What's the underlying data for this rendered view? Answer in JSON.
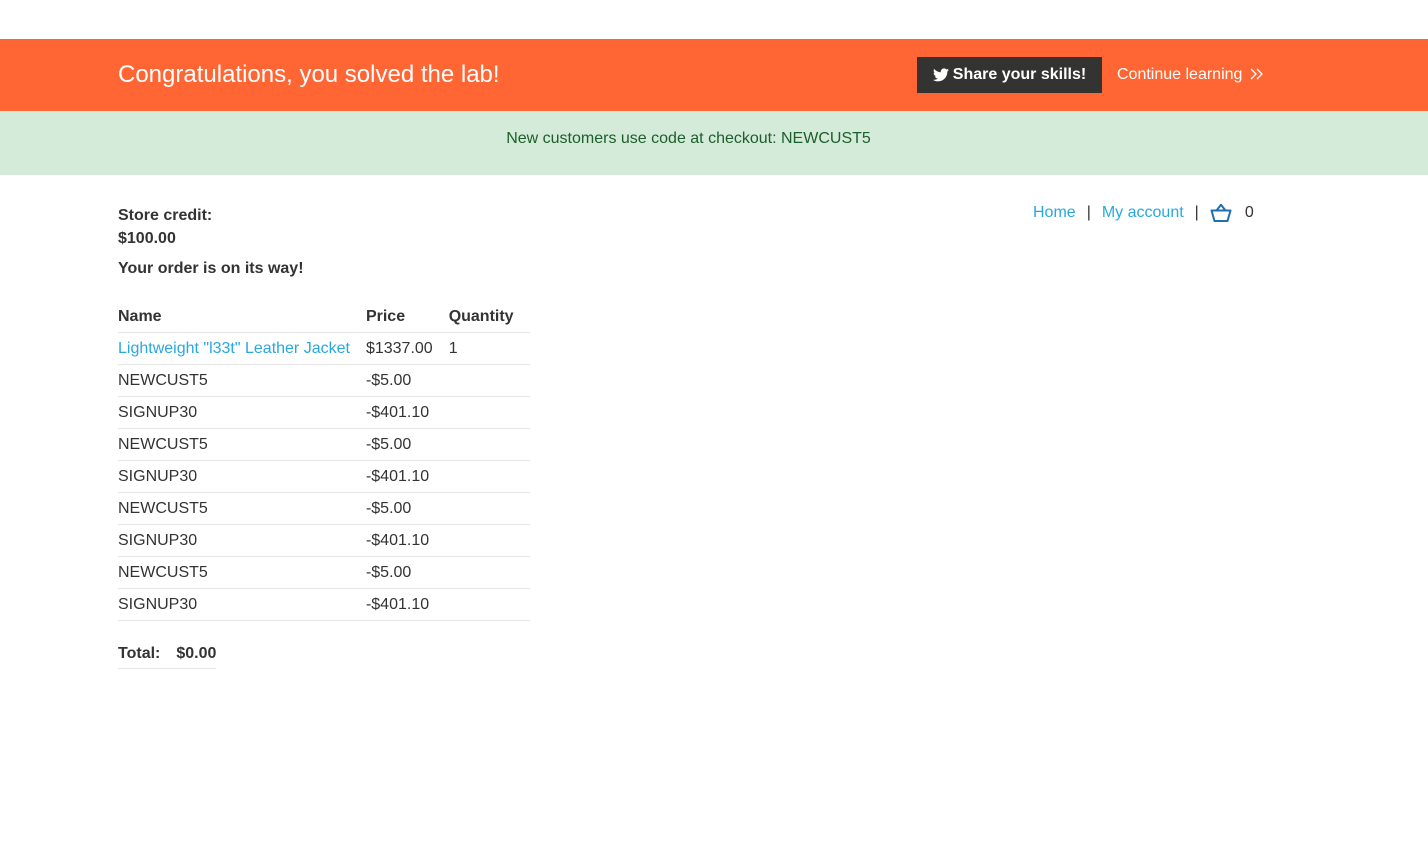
{
  "banner": {
    "title": "Congratulations, you solved the lab!",
    "share_label": "Share your skills!",
    "continue_label": "Continue learning"
  },
  "notice": {
    "text": "New customers use code at checkout: NEWCUST5"
  },
  "account": {
    "store_credit_label": "Store credit:",
    "store_credit_value": "$100.00"
  },
  "nav": {
    "home": "Home",
    "my_account": "My account",
    "separator": "|",
    "cart_count": "0"
  },
  "order": {
    "message": "Your order is on its way!",
    "headers": [
      "Name",
      "Price",
      "Quantity"
    ],
    "rows": [
      {
        "name": "Lightweight \"l33t\" Leather Jacket",
        "price": "$1337.00",
        "quantity": "1"
      },
      {
        "name": "NEWCUST5",
        "price": "-$5.00",
        "quantity": ""
      },
      {
        "name": "SIGNUP30",
        "price": "-$401.10",
        "quantity": ""
      },
      {
        "name": "NEWCUST5",
        "price": "-$5.00",
        "quantity": ""
      },
      {
        "name": "SIGNUP30",
        "price": "-$401.10",
        "quantity": ""
      },
      {
        "name": "NEWCUST5",
        "price": "-$5.00",
        "quantity": ""
      },
      {
        "name": "SIGNUP30",
        "price": "-$401.10",
        "quantity": ""
      },
      {
        "name": "NEWCUST5",
        "price": "-$5.00",
        "quantity": ""
      },
      {
        "name": "SIGNUP30",
        "price": "-$401.10",
        "quantity": ""
      }
    ],
    "total_label": "Total:",
    "total_value": "$0.00"
  },
  "colors": {
    "banner_bg": "#ff6633",
    "notice_bg": "#d4ebd9",
    "link": "#29a8df",
    "share_bg": "#333332"
  },
  "icons": {
    "share": "twitter-icon",
    "continue": "double-chevron-right-icon",
    "cart": "basket-icon"
  }
}
